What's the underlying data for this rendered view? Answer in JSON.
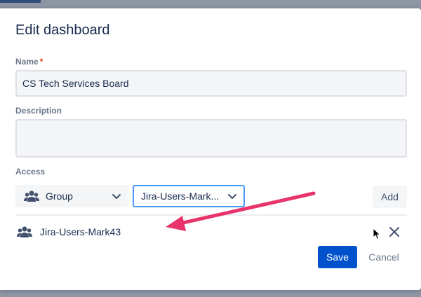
{
  "dialog": {
    "title": "Edit dashboard",
    "name_label": "Name",
    "name_required_marker": "*",
    "name_value": "CS Tech Services Board",
    "description_label": "Description",
    "description_value": "",
    "access_label": "Access",
    "access_type": {
      "icon": "group-icon",
      "selected": "Group"
    },
    "access_member": {
      "selected": "Jira-Users-Mark..."
    },
    "add_label": "Add",
    "members": [
      {
        "icon": "group-icon",
        "name": "Jira-Users-Mark43"
      }
    ],
    "save_label": "Save",
    "cancel_label": "Cancel"
  },
  "colors": {
    "primary": "#0052cc",
    "focus_border": "#4c9aff",
    "annotation_arrow": "#e8336b",
    "required": "#de350b"
  }
}
